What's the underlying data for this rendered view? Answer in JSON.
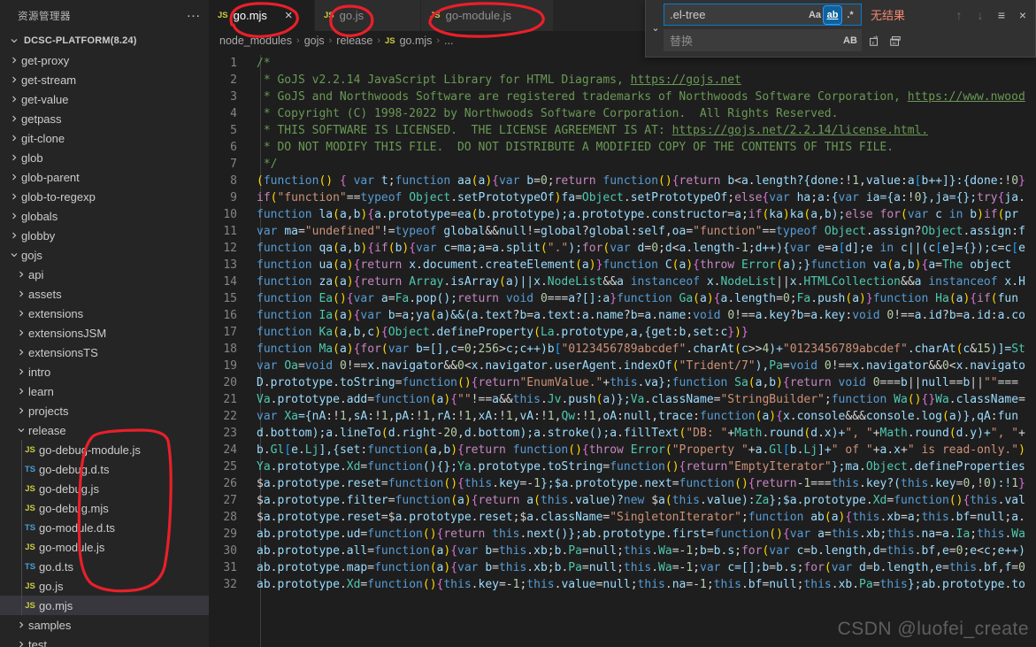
{
  "sidebar": {
    "header_title": "资源管理器",
    "more_actions": "...",
    "root_label": "DCSC-PLATFORM(8.24)",
    "items": [
      {
        "label": "get-proxy",
        "type": "folder",
        "depth": 1,
        "expanded": false
      },
      {
        "label": "get-stream",
        "type": "folder",
        "depth": 1,
        "expanded": false
      },
      {
        "label": "get-value",
        "type": "folder",
        "depth": 1,
        "expanded": false
      },
      {
        "label": "getpass",
        "type": "folder",
        "depth": 1,
        "expanded": false
      },
      {
        "label": "git-clone",
        "type": "folder",
        "depth": 1,
        "expanded": false
      },
      {
        "label": "glob",
        "type": "folder",
        "depth": 1,
        "expanded": false
      },
      {
        "label": "glob-parent",
        "type": "folder",
        "depth": 1,
        "expanded": false
      },
      {
        "label": "glob-to-regexp",
        "type": "folder",
        "depth": 1,
        "expanded": false
      },
      {
        "label": "globals",
        "type": "folder",
        "depth": 1,
        "expanded": false
      },
      {
        "label": "globby",
        "type": "folder",
        "depth": 1,
        "expanded": false
      },
      {
        "label": "gojs",
        "type": "folder",
        "depth": 1,
        "expanded": true
      },
      {
        "label": "api",
        "type": "folder",
        "depth": 2,
        "expanded": false
      },
      {
        "label": "assets",
        "type": "folder",
        "depth": 2,
        "expanded": false
      },
      {
        "label": "extensions",
        "type": "folder",
        "depth": 2,
        "expanded": false
      },
      {
        "label": "extensionsJSM",
        "type": "folder",
        "depth": 2,
        "expanded": false
      },
      {
        "label": "extensionsTS",
        "type": "folder",
        "depth": 2,
        "expanded": false
      },
      {
        "label": "intro",
        "type": "folder",
        "depth": 2,
        "expanded": false
      },
      {
        "label": "learn",
        "type": "folder",
        "depth": 2,
        "expanded": false
      },
      {
        "label": "projects",
        "type": "folder",
        "depth": 2,
        "expanded": false
      },
      {
        "label": "release",
        "type": "folder",
        "depth": 2,
        "expanded": true
      },
      {
        "label": "go-debug-module.js",
        "type": "js",
        "depth": 3,
        "selected": false
      },
      {
        "label": "go-debug.d.ts",
        "type": "ts",
        "depth": 3,
        "selected": false
      },
      {
        "label": "go-debug.js",
        "type": "js",
        "depth": 3,
        "selected": false
      },
      {
        "label": "go-debug.mjs",
        "type": "js",
        "depth": 3,
        "selected": false
      },
      {
        "label": "go-module.d.ts",
        "type": "ts",
        "depth": 3,
        "selected": false
      },
      {
        "label": "go-module.js",
        "type": "js",
        "depth": 3,
        "selected": false
      },
      {
        "label": "go.d.ts",
        "type": "ts",
        "depth": 3,
        "selected": false
      },
      {
        "label": "go.js",
        "type": "js",
        "depth": 3,
        "selected": false
      },
      {
        "label": "go.mjs",
        "type": "js",
        "depth": 3,
        "selected": true
      },
      {
        "label": "samples",
        "type": "folder",
        "depth": 2,
        "expanded": false
      },
      {
        "label": "test",
        "type": "folder",
        "depth": 2,
        "expanded": false
      }
    ]
  },
  "tabs": [
    {
      "label": "go.mjs",
      "icon": "JS",
      "active": true,
      "close": "×"
    },
    {
      "label": "go.js",
      "icon": "JS",
      "active": false
    },
    {
      "label": "go-module.js",
      "icon": "JS",
      "active": false
    }
  ],
  "breadcrumb": {
    "parts": [
      "node_modules",
      "gojs",
      "release"
    ],
    "file": "go.mjs",
    "file_icon": "JS",
    "ellipsis": "...",
    "separator": "›"
  },
  "find_widget": {
    "search_value": ".el-tree",
    "replace_placeholder": "替换",
    "result_text": "无结果",
    "match_case_label": "Aa",
    "whole_word_label": "ab",
    "regex_label": ".*",
    "preserve_case_label": "AB",
    "prev_label": "↑",
    "next_label": "↓",
    "selection_label": "≡",
    "close_label": "×",
    "expand_label": "⌄",
    "whole_word_active": true,
    "accent_color": "#0e639c",
    "result_color": "#f48771"
  },
  "editor": {
    "first_line": 1,
    "last_line": 32,
    "lines": [
      "/*",
      " * GoJS v2.2.14 JavaScript Library for HTML Diagrams, https://gojs.net",
      " * GoJS and Northwoods Software are registered trademarks of Northwoods Software Corporation, https://www.nwood",
      " * Copyright (C) 1998-2022 by Northwoods Software Corporation.  All Rights Reserved.",
      " * THIS SOFTWARE IS LICENSED.  THE LICENSE AGREEMENT IS AT: https://gojs.net/2.2.14/license.html.",
      " * DO NOT MODIFY THIS FILE.  DO NOT DISTRIBUTE A MODIFIED COPY OF THE CONTENTS OF THIS FILE.",
      " */",
      "(function() { var t;function aa(a){var b=0;return function(){return b<a.length?{done:!1,value:a[b++]}:{done:!0}",
      "if(\"function\"==typeof Object.setPrototypeOf)fa=Object.setPrototypeOf;else{var ha;a:{var ia={a:!0},ja={};try{ja.",
      "function la(a,b){a.prototype=ea(b.prototype);a.prototype.constructor=a;if(ka)ka(a,b);else for(var c in b)if(\"pr",
      "var ma=\"undefined\"!=typeof global&&null!=global?global:self,oa=\"function\"==typeof Object.assign?Object.assign:f",
      "function qa(a,b){if(b){var c=ma;a=a.split(\".\");for(var d=0;d<a.length-1;d++){var e=a[d];e in c||(c[e]={});c=c[e",
      "function ua(a){return x.document.createElement(a)}function C(a){throw Error(a);}function va(a,b){a=\"The object",
      "function za(a){return Array.isArray(a)||x.NodeList&&a instanceof x.NodeList||x.HTMLCollection&&a instanceof x.H",
      "function Ea(){var a=Fa.pop();return void 0===a?[]:a}function Ga(a){a.length=0;Fa.push(a)}function Ha(a){if(\"fun",
      "function Ia(a){var b=a;ya(a)&&(a.text?b=a.text:a.name?b=a.name:void 0!==a.key?b=a.key:void 0!==a.id?b=a.id:a.co",
      "function Ka(a,b,c){Object.defineProperty(La.prototype,a,{get:b,set:c})}",
      "function Ma(a){for(var b=[],c=0;256>c;c++)b[\"0123456789abcdef\".charAt(c>>4)+\"0123456789abcdef\".charAt(c&15)]=St",
      "var Oa=void 0!==x.navigator&&0<x.navigator.userAgent.indexOf(\"Trident/7\"),Pa=void 0!==x.navigator&&0<x.navigato",
      "D.prototype.toString=function(){return\"EnumValue.\"+this.va};function Sa(a,b){return void 0===b||null==b||\"\"===",
      "Va.prototype.add=function(a){\"\"!==a&&this.Jv.push(a)};Va.className=\"StringBuilder\";function Wa(){}Wa.className=",
      "var Xa={nA:!1,sA:!1,pA:!1,rA:!1,xA:!1,vA:!1,Qw:!1,oA:null,trace:function(a){x.console&&&console.log(a)},qA:fun",
      "d.bottom);a.lineTo(d.right-20,d.bottom);a.stroke();a.fillText(\"DB: \"+Math.round(d.x)+\", \"+Math.round(d.y)+\", \"+",
      "b.Gl[e.Lj],{set:function(a,b){return function(){throw Error(\"Property \"+a.Gl[b.Lj]+\" of \"+a.x+\" is read-only.\")",
      "Ya.prototype.Xd=function(){};Ya.prototype.toString=function(){return\"EmptyIterator\"};ma.Object.defineProperties",
      "$a.prototype.reset=function(){this.key=-1};$a.prototype.next=function(){return-1===this.key?(this.key=0,!0):!1}",
      "$a.prototype.filter=function(a){return a(this.value)?new $a(this.value):Za};$a.prototype.Xd=function(){this.val",
      "$a.prototype.reset=$a.prototype.reset;$a.className=\"SingletonIterator\";function ab(a){this.xb=a;this.bf=null;a.",
      "ab.prototype.ud=function(){return this.next()};ab.prototype.first=function(){var a=this.xb;this.na=a.Ia;this.Wa",
      "ab.prototype.all=function(a){var b=this.xb;b.Pa=null;this.Wa=-1;b=b.s;for(var c=b.length,d=this.bf,e=0;e<c;e++)",
      "ab.prototype.map=function(a){var b=this.xb;b.Pa=null;this.Wa=-1;var c=[];b=b.s;for(var d=b.length,e=this.bf,f=0",
      "ab.prototype.Xd=function(){this.key=-1;this.value=null;this.na=-1;this.bf=null;this.xb.Pa=this};ab.prototype.to"
    ]
  },
  "watermark": "CSDN @luofei_create",
  "theme": {
    "editor_bg": "#1e1e1e",
    "sidebar_bg": "#252526",
    "tab_inactive_bg": "#2d2d2d",
    "selection_bg": "#37373d",
    "annotation_color": "#e8202a"
  }
}
